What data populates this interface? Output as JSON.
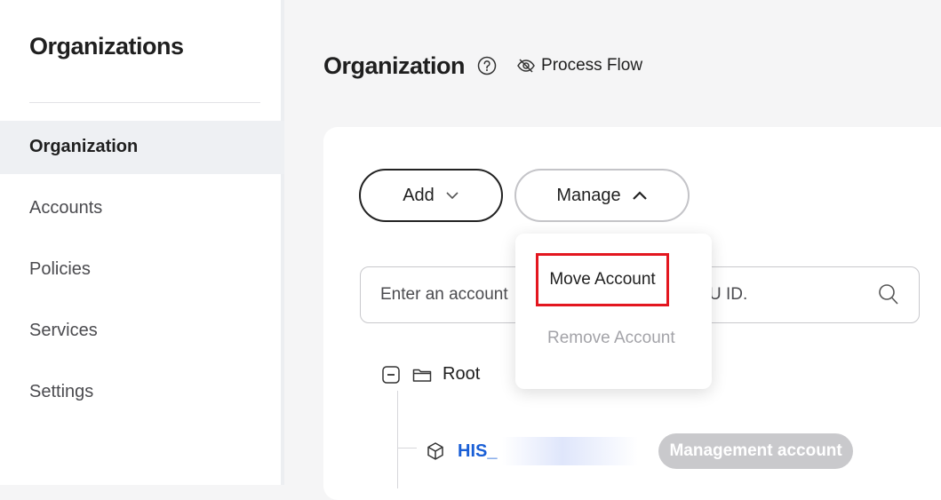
{
  "sidebar": {
    "title": "Organizations",
    "items": [
      {
        "label": "Organization",
        "active": true
      },
      {
        "label": "Accounts"
      },
      {
        "label": "Policies"
      },
      {
        "label": "Services"
      },
      {
        "label": "Settings"
      }
    ]
  },
  "header": {
    "title": "Organization",
    "help_icon": "help-circle-icon",
    "process_flow_label": "Process Flow",
    "process_flow_icon": "eye-off-icon"
  },
  "toolbar": {
    "add_label": "Add",
    "manage_label": "Manage"
  },
  "search": {
    "placeholder_visible": "Enter an account",
    "placeholder_tail": "U ID.",
    "icon": "search-icon"
  },
  "manage_menu": {
    "items": [
      {
        "label": "Move Account",
        "highlighted": true
      },
      {
        "label": "Remove Account",
        "disabled": true
      }
    ]
  },
  "tree": {
    "root_label": "Root",
    "account": {
      "name_prefix": "HIS_",
      "badge": "Management account"
    }
  },
  "colors": {
    "accent_link": "#1a5fd6",
    "highlight_border": "#e3161f",
    "badge_bg": "#c9c9cc"
  }
}
